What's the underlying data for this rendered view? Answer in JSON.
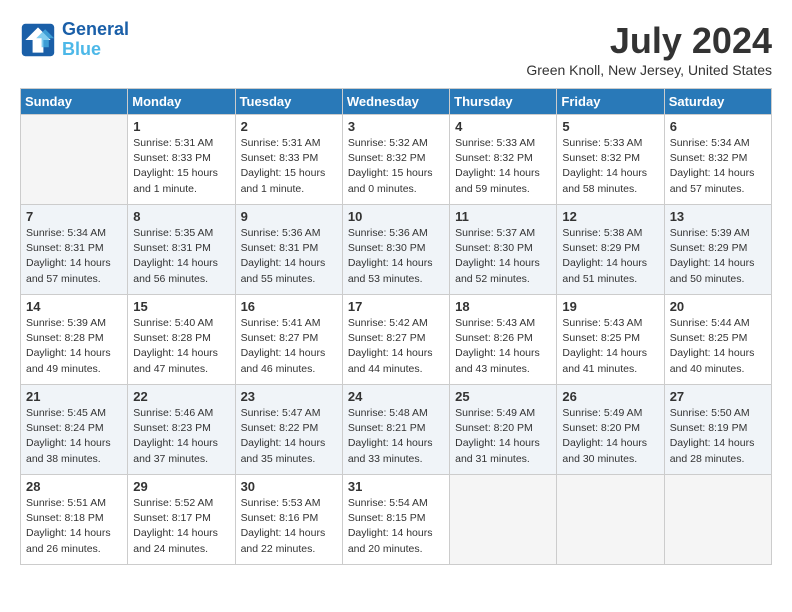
{
  "header": {
    "logo_line1": "General",
    "logo_line2": "Blue",
    "title": "July 2024",
    "subtitle": "Green Knoll, New Jersey, United States"
  },
  "weekdays": [
    "Sunday",
    "Monday",
    "Tuesday",
    "Wednesday",
    "Thursday",
    "Friday",
    "Saturday"
  ],
  "weeks": [
    [
      {
        "day": "",
        "detail": ""
      },
      {
        "day": "1",
        "detail": "Sunrise: 5:31 AM\nSunset: 8:33 PM\nDaylight: 15 hours\nand 1 minute."
      },
      {
        "day": "2",
        "detail": "Sunrise: 5:31 AM\nSunset: 8:33 PM\nDaylight: 15 hours\nand 1 minute."
      },
      {
        "day": "3",
        "detail": "Sunrise: 5:32 AM\nSunset: 8:32 PM\nDaylight: 15 hours\nand 0 minutes."
      },
      {
        "day": "4",
        "detail": "Sunrise: 5:33 AM\nSunset: 8:32 PM\nDaylight: 14 hours\nand 59 minutes."
      },
      {
        "day": "5",
        "detail": "Sunrise: 5:33 AM\nSunset: 8:32 PM\nDaylight: 14 hours\nand 58 minutes."
      },
      {
        "day": "6",
        "detail": "Sunrise: 5:34 AM\nSunset: 8:32 PM\nDaylight: 14 hours\nand 57 minutes."
      }
    ],
    [
      {
        "day": "7",
        "detail": "Sunrise: 5:34 AM\nSunset: 8:31 PM\nDaylight: 14 hours\nand 57 minutes."
      },
      {
        "day": "8",
        "detail": "Sunrise: 5:35 AM\nSunset: 8:31 PM\nDaylight: 14 hours\nand 56 minutes."
      },
      {
        "day": "9",
        "detail": "Sunrise: 5:36 AM\nSunset: 8:31 PM\nDaylight: 14 hours\nand 55 minutes."
      },
      {
        "day": "10",
        "detail": "Sunrise: 5:36 AM\nSunset: 8:30 PM\nDaylight: 14 hours\nand 53 minutes."
      },
      {
        "day": "11",
        "detail": "Sunrise: 5:37 AM\nSunset: 8:30 PM\nDaylight: 14 hours\nand 52 minutes."
      },
      {
        "day": "12",
        "detail": "Sunrise: 5:38 AM\nSunset: 8:29 PM\nDaylight: 14 hours\nand 51 minutes."
      },
      {
        "day": "13",
        "detail": "Sunrise: 5:39 AM\nSunset: 8:29 PM\nDaylight: 14 hours\nand 50 minutes."
      }
    ],
    [
      {
        "day": "14",
        "detail": "Sunrise: 5:39 AM\nSunset: 8:28 PM\nDaylight: 14 hours\nand 49 minutes."
      },
      {
        "day": "15",
        "detail": "Sunrise: 5:40 AM\nSunset: 8:28 PM\nDaylight: 14 hours\nand 47 minutes."
      },
      {
        "day": "16",
        "detail": "Sunrise: 5:41 AM\nSunset: 8:27 PM\nDaylight: 14 hours\nand 46 minutes."
      },
      {
        "day": "17",
        "detail": "Sunrise: 5:42 AM\nSunset: 8:27 PM\nDaylight: 14 hours\nand 44 minutes."
      },
      {
        "day": "18",
        "detail": "Sunrise: 5:43 AM\nSunset: 8:26 PM\nDaylight: 14 hours\nand 43 minutes."
      },
      {
        "day": "19",
        "detail": "Sunrise: 5:43 AM\nSunset: 8:25 PM\nDaylight: 14 hours\nand 41 minutes."
      },
      {
        "day": "20",
        "detail": "Sunrise: 5:44 AM\nSunset: 8:25 PM\nDaylight: 14 hours\nand 40 minutes."
      }
    ],
    [
      {
        "day": "21",
        "detail": "Sunrise: 5:45 AM\nSunset: 8:24 PM\nDaylight: 14 hours\nand 38 minutes."
      },
      {
        "day": "22",
        "detail": "Sunrise: 5:46 AM\nSunset: 8:23 PM\nDaylight: 14 hours\nand 37 minutes."
      },
      {
        "day": "23",
        "detail": "Sunrise: 5:47 AM\nSunset: 8:22 PM\nDaylight: 14 hours\nand 35 minutes."
      },
      {
        "day": "24",
        "detail": "Sunrise: 5:48 AM\nSunset: 8:21 PM\nDaylight: 14 hours\nand 33 minutes."
      },
      {
        "day": "25",
        "detail": "Sunrise: 5:49 AM\nSunset: 8:20 PM\nDaylight: 14 hours\nand 31 minutes."
      },
      {
        "day": "26",
        "detail": "Sunrise: 5:49 AM\nSunset: 8:20 PM\nDaylight: 14 hours\nand 30 minutes."
      },
      {
        "day": "27",
        "detail": "Sunrise: 5:50 AM\nSunset: 8:19 PM\nDaylight: 14 hours\nand 28 minutes."
      }
    ],
    [
      {
        "day": "28",
        "detail": "Sunrise: 5:51 AM\nSunset: 8:18 PM\nDaylight: 14 hours\nand 26 minutes."
      },
      {
        "day": "29",
        "detail": "Sunrise: 5:52 AM\nSunset: 8:17 PM\nDaylight: 14 hours\nand 24 minutes."
      },
      {
        "day": "30",
        "detail": "Sunrise: 5:53 AM\nSunset: 8:16 PM\nDaylight: 14 hours\nand 22 minutes."
      },
      {
        "day": "31",
        "detail": "Sunrise: 5:54 AM\nSunset: 8:15 PM\nDaylight: 14 hours\nand 20 minutes."
      },
      {
        "day": "",
        "detail": ""
      },
      {
        "day": "",
        "detail": ""
      },
      {
        "day": "",
        "detail": ""
      }
    ]
  ]
}
